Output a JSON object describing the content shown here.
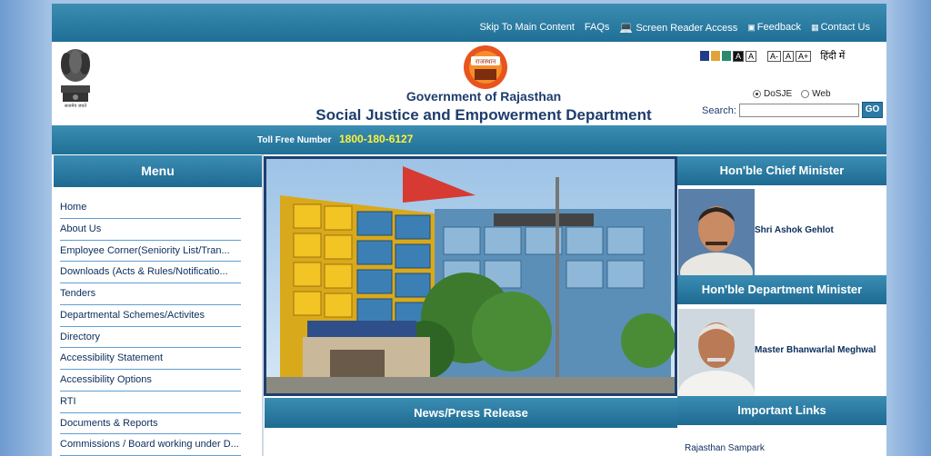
{
  "top_links": {
    "skip": "Skip To Main Content",
    "faqs": "FAQs",
    "screen_reader": "Screen Reader Access",
    "feedback": "Feedback",
    "contact": "Contact Us"
  },
  "header": {
    "emblem_caption": "सत्यमेव जयते",
    "gov_title": "Government of Rajasthan",
    "dept_title": "Social Justice and Empowerment Department",
    "logo_text": "राजस्थान"
  },
  "accessibility": {
    "contrast_swatches": [
      "#1f3c88",
      "#e1a23a",
      "#2a8a6e",
      "#111111"
    ],
    "contrast_letter": "A",
    "contrast_letter_2": "A",
    "font_decrease": "A-",
    "font_normal": "A",
    "font_increase": "A+",
    "hindi": "हिंदी में"
  },
  "search": {
    "option_1": "DoSJE",
    "option_2": "Web",
    "label": "Search:",
    "placeholder": "",
    "button": "GO",
    "selected": "DoSJE"
  },
  "toll": {
    "label": "Toll Free Number",
    "number": "1800-180-6127"
  },
  "menu": {
    "title": "Menu",
    "items": [
      "Home",
      "About Us",
      "Employee Corner(Seniority List/Tran...",
      "Downloads (Acts & Rules/Notificatio...",
      "Tenders",
      "Departmental Schemes/Activites",
      "Directory",
      "Accessibility Statement",
      "Accessibility Options",
      "RTI",
      "Documents & Reports",
      "Commissions / Board working under D..."
    ]
  },
  "main": {
    "news_title": "News/Press Release"
  },
  "right": {
    "cm_title": "Hon'ble Chief Minister",
    "cm_name": "Shri Ashok Gehlot",
    "minister_title": "Hon'ble Department Minister",
    "minister_name": "Master Bhanwarlal Meghwal",
    "links_title": "Important Links",
    "links": [
      "Rajasthan Sampark"
    ]
  },
  "colors": {
    "bar": "#1f6f96",
    "title": "#1d3d6e",
    "toll_number": "#fff23a"
  }
}
